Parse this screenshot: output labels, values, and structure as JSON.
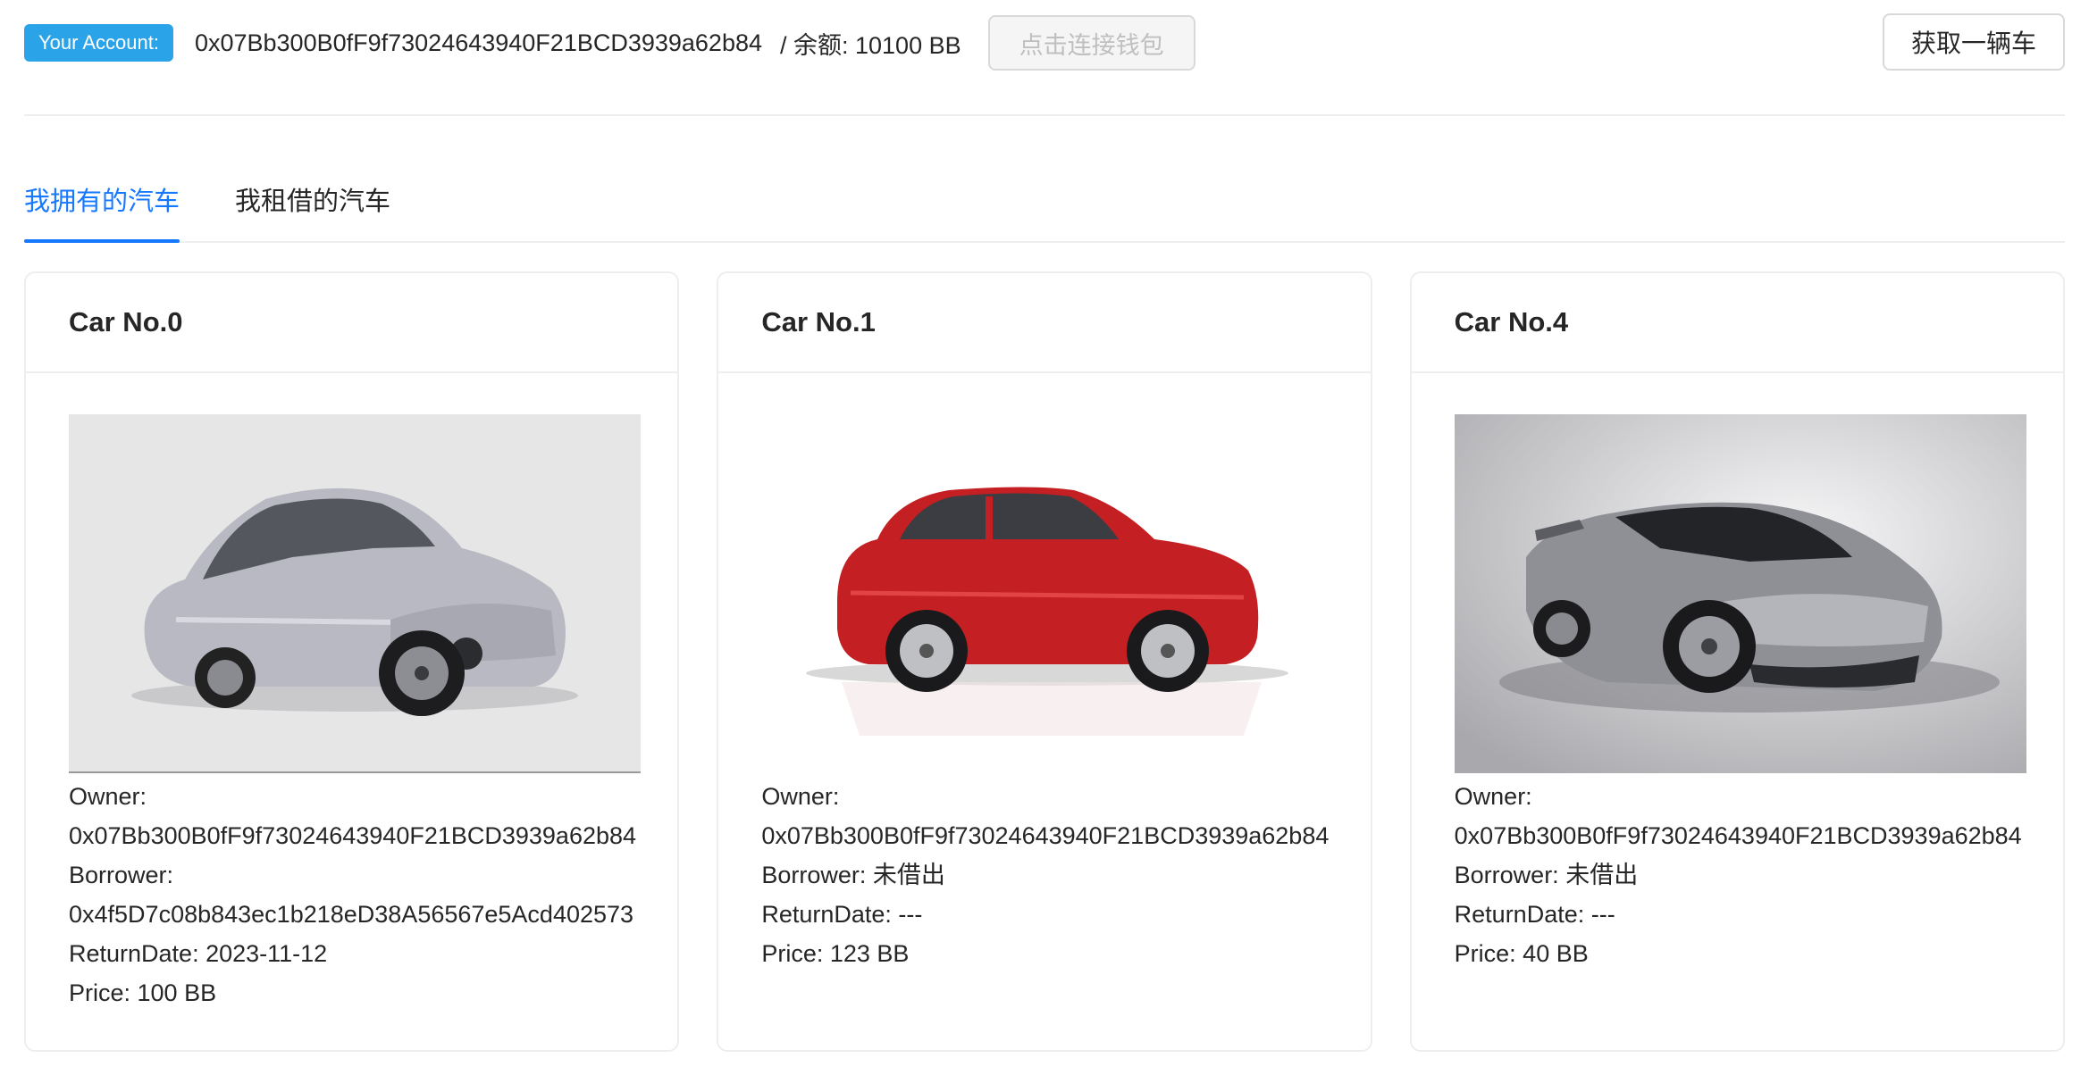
{
  "header": {
    "account_tag": "Your Account:",
    "account_address": "0x07Bb300B0fF9f73024643940F21BCD3939a62b84",
    "balance_text": "/ 余额: 10100 BB",
    "connect_button": "点击连接钱包",
    "get_car_button": "获取一辆车"
  },
  "tabs": [
    {
      "label": "我拥有的汽车",
      "active": true
    },
    {
      "label": "我租借的汽车",
      "active": false
    }
  ],
  "cards": [
    {
      "title": "Car No.0",
      "image": "silver-sedan",
      "owner_label": "Owner:",
      "owner": "0x07Bb300B0fF9f73024643940F21BCD3939a62b84",
      "borrower_label": "Borrower:",
      "borrower": "0x4f5D7c08b843ec1b218eD38A56567e5Acd402573",
      "return_date": "ReturnDate: 2023-11-12",
      "price": "Price: 100 BB"
    },
    {
      "title": "Car No.1",
      "image": "red-hatchback",
      "owner_label": "Owner:",
      "owner": "0x07Bb300B0fF9f73024643940F21BCD3939a62b84",
      "borrower_line": "Borrower: 未借出",
      "return_date": "ReturnDate: ---",
      "price": "Price: 123 BB"
    },
    {
      "title": "Car No.4",
      "image": "silver-sports-car",
      "owner_label": "Owner:",
      "owner": "0x07Bb300B0fF9f73024643940F21BCD3939a62b84",
      "borrower_line": "Borrower: 未借出",
      "return_date": "ReturnDate: ---",
      "price": "Price: 40 BB"
    }
  ],
  "colors": {
    "accent": "#1677ff",
    "account_tag_bg": "#2aa3e8",
    "border": "#eeeeee"
  }
}
